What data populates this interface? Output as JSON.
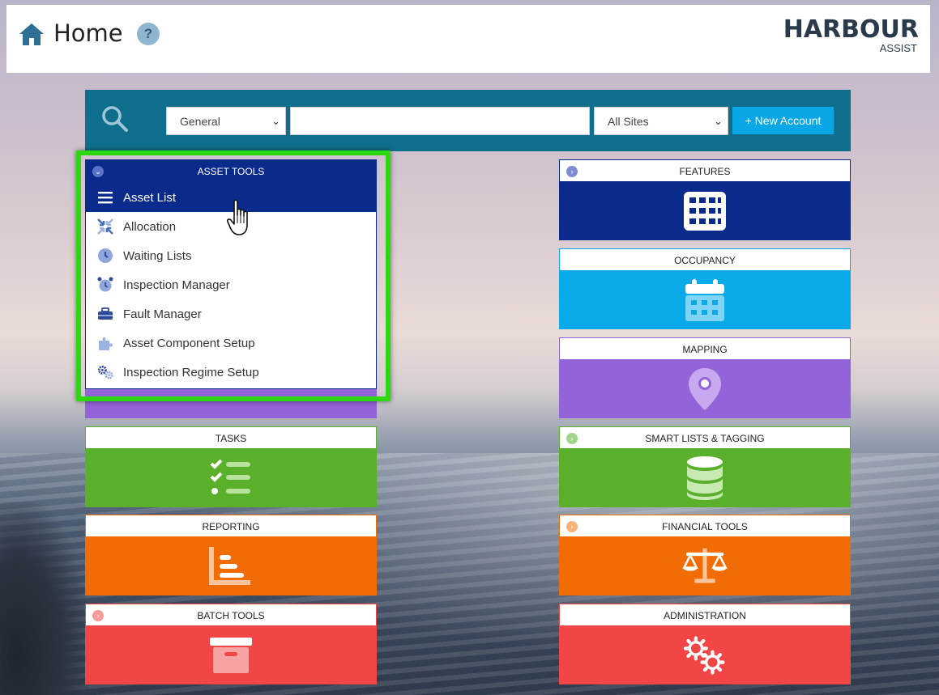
{
  "header": {
    "title": "Home",
    "help_label": "?",
    "logo_main": "HARBOUR",
    "logo_sub": "ASSIST"
  },
  "search": {
    "category_value": "General",
    "query_value": "",
    "sites_value": "All Sites",
    "new_account_label": "+ New Account"
  },
  "asset_tools": {
    "title": "ASSET TOOLS",
    "items": [
      {
        "label": "Asset List",
        "icon": "list-icon"
      },
      {
        "label": "Allocation",
        "icon": "arrows-in-icon"
      },
      {
        "label": "Waiting Lists",
        "icon": "clock-icon"
      },
      {
        "label": "Inspection Manager",
        "icon": "alarm-clock-icon"
      },
      {
        "label": "Fault Manager",
        "icon": "toolbox-icon"
      },
      {
        "label": "Asset Component Setup",
        "icon": "puzzle-icon"
      },
      {
        "label": "Inspection Regime Setup",
        "icon": "cogs-icon"
      }
    ]
  },
  "tiles": {
    "tasks": {
      "title": "TASKS",
      "color": "#5aaf2b",
      "icon": "checklist-icon"
    },
    "reporting": {
      "title": "REPORTING",
      "color": "#f26c05",
      "icon": "bar-chart-icon"
    },
    "batch_tools": {
      "title": "BATCH TOOLS",
      "color": "#f24646",
      "icon": "archive-box-icon"
    },
    "features": {
      "title": "FEATURES",
      "color": "#0a2a8c",
      "icon": "grid-icon"
    },
    "occupancy": {
      "title": "OCCUPANCY",
      "color": "#0aaae8",
      "icon": "calendar-icon"
    },
    "mapping": {
      "title": "MAPPING",
      "color": "#9363d9",
      "icon": "map-pin-icon"
    },
    "smart_lists": {
      "title": "SMART LISTS & TAGGING",
      "color": "#5aaf2b",
      "icon": "database-icon"
    },
    "financial_tools": {
      "title": "FINANCIAL TOOLS",
      "color": "#f26c05",
      "icon": "scales-icon"
    },
    "administration": {
      "title": "ADMINISTRATION",
      "color": "#f24646",
      "icon": "gears-icon"
    }
  }
}
